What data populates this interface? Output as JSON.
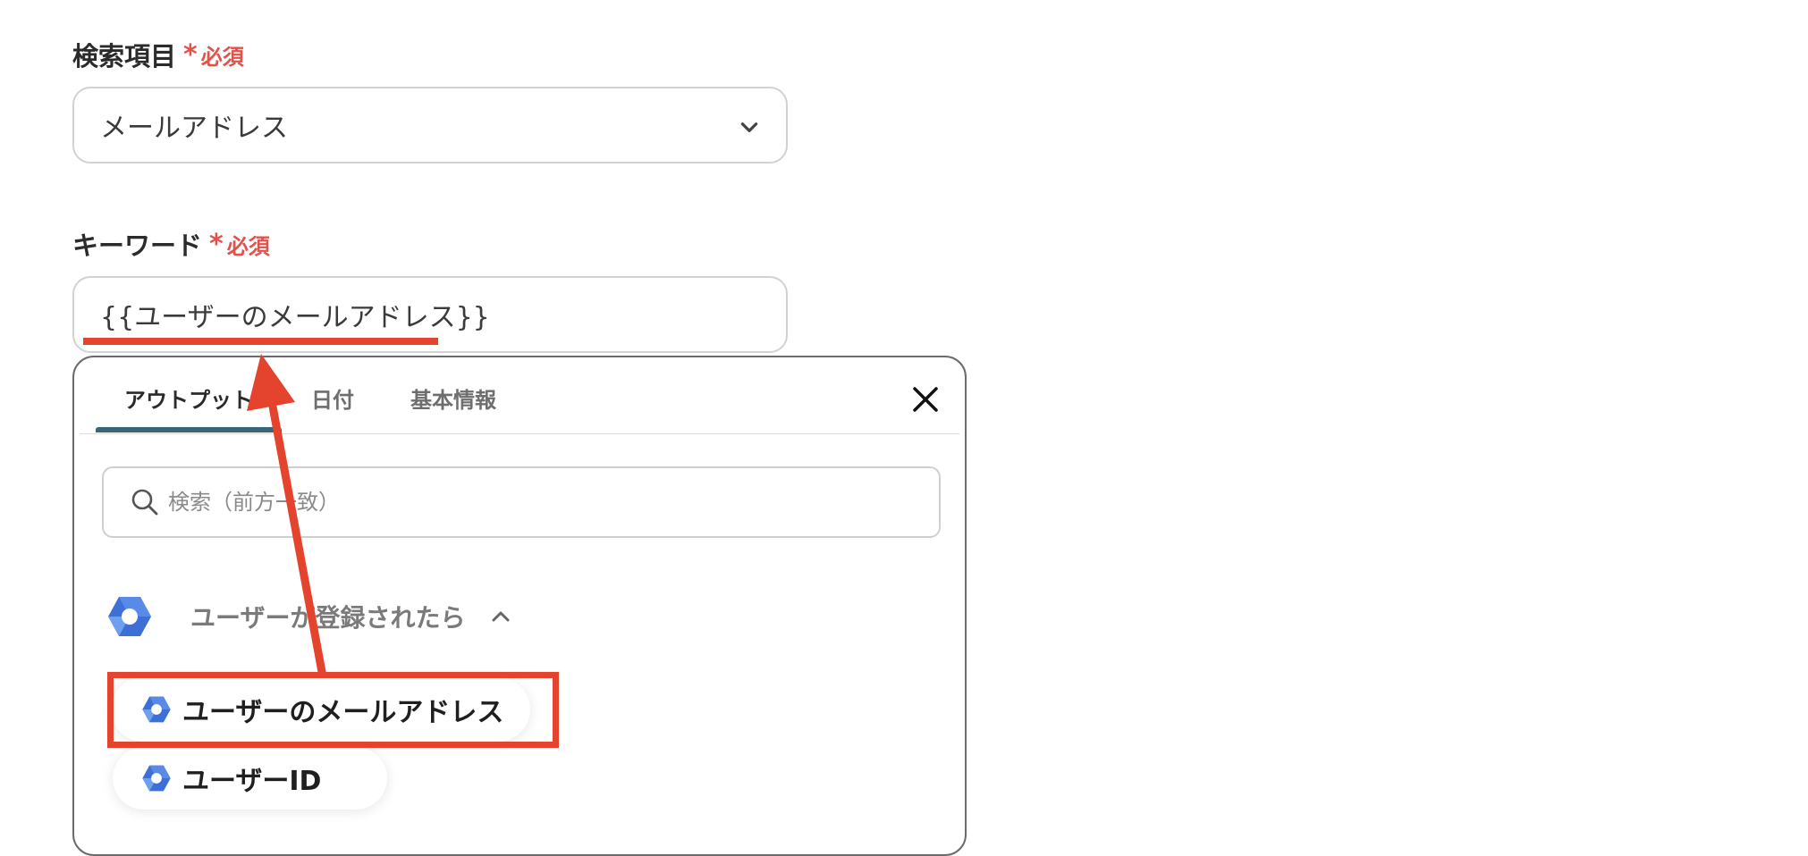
{
  "search_field_label": {
    "label": "検索項目",
    "required_star": "*",
    "required_text": "必須"
  },
  "search_field": {
    "value": "メールアドレス",
    "icon": "chevron-down-icon"
  },
  "keyword_field_label": {
    "label": "キーワード",
    "required_star": "*",
    "required_text": "必須"
  },
  "keyword_field": {
    "value": "{{ユーザーのメールアドレス}}"
  },
  "output_panel": {
    "tabs": [
      {
        "label": "アウトプット",
        "active": true
      },
      {
        "label": "日付",
        "active": false
      },
      {
        "label": "基本情報",
        "active": false
      }
    ],
    "close_icon": "close-icon",
    "search": {
      "placeholder": "検索（前方一致）",
      "icon": "search-icon"
    },
    "group": {
      "title": "ユーザーが登録されたら",
      "icon": "google-workspace-icon",
      "toggle_icon": "chevron-up-icon"
    },
    "items": [
      {
        "label": "ユーザーのメールアドレス",
        "icon": "google-workspace-icon"
      },
      {
        "label": "ユーザーID",
        "icon": "google-workspace-icon"
      }
    ]
  },
  "colors": {
    "required": "#e2514a",
    "tab_active_underline": "#3a6478",
    "annotation": "#e4432d",
    "icon_blue_dark": "#3d6fd6",
    "icon_blue_light": "#6fa0f0"
  }
}
